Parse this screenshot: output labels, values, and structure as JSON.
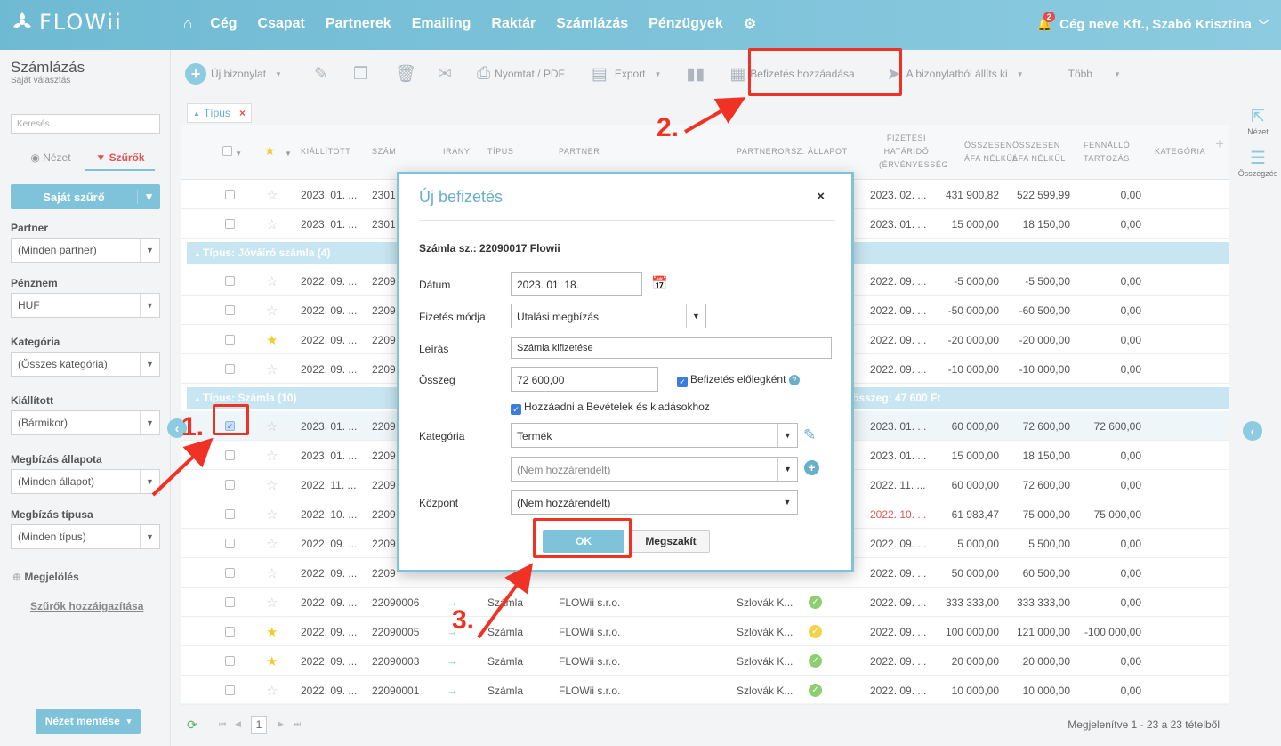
{
  "app": {
    "logo_text": "FLOWii",
    "company_user": "Cég neve Kft., Szabó Krisztina",
    "notification_count": "2"
  },
  "nav": [
    "Cég",
    "Csapat",
    "Partnerek",
    "Emailing",
    "Raktár",
    "Számlázás",
    "Pénzügyek"
  ],
  "sidebar": {
    "title": "Számlázás",
    "subtitle": "Saját választás",
    "search_placeholder": "Keresés...",
    "tab_view": "Nézet",
    "tab_filters": "Szűrők",
    "own_filter": "Saját szűrő",
    "filters": [
      {
        "label": "Partner",
        "value": "(Minden partner)"
      },
      {
        "label": "Pénznem",
        "value": "HUF"
      },
      {
        "label": "Kategória",
        "value": "(Összes kategória)"
      },
      {
        "label": "Kiállított",
        "value": "(Bármikor)"
      },
      {
        "label": "Megbízás állapota",
        "value": "(Minden állapot)"
      },
      {
        "label": "Megbízás típusa",
        "value": "(Minden típus)"
      }
    ],
    "mark": "Megjelölés",
    "assign_filters": "Szűrők hozzáigazítása",
    "save_view": "Nézet mentése"
  },
  "toolbar": {
    "new_doc": "Új bizonylat",
    "print": "Nyomtat / PDF",
    "export": "Export",
    "add_payment": "Befizetés hozzáadása",
    "create_from": "A bizonylatból állíts ki",
    "more": "Több"
  },
  "filter_chip": "Típus",
  "columns": {
    "issued": "KIÁLLÍTOTT",
    "number": "SZÁM",
    "direction": "IRÁNY",
    "type": "TÍPUS",
    "partner": "PARTNER",
    "country": "PARTNERORSZ.",
    "status": "ÁLLAPOT",
    "due1": "FIZETÉSI",
    "due2": "HATÁRIDŐ",
    "due3": "(ÉRVÉNYESSÉG",
    "net1": "ÖSSZESEN",
    "net2": "ÁFA NÉLKÜL",
    "gross1": "ÖSSZESEN",
    "gross2": "ÁFA NÉLKÜL",
    "debt1": "FENNÁLLÓ",
    "debt2": "TARTOZÁS",
    "category": "KATEGÓRIA"
  },
  "groups": [
    {
      "label": "Típus: Jóváíró számla (4)"
    },
    {
      "label": "Típus: Számla (10)",
      "sum": "összeg: 47 600 Ft"
    }
  ],
  "rows": [
    {
      "issued": "2023. 01. ...",
      "number": "2301",
      "due": "2023. 02. ...",
      "net": "431 900,82",
      "gross": "522 599,99",
      "debt": "0,00",
      "star": false
    },
    {
      "issued": "2023. 01. ...",
      "number": "2301",
      "due": "2023. 01. ...",
      "net": "15 000,00",
      "gross": "18 150,00",
      "debt": "0,00",
      "star": false
    },
    {
      "issued": "2022. 09. ...",
      "number": "2209",
      "due": "2022. 09. ...",
      "net": "-5 000,00",
      "gross": "-5 500,00",
      "debt": "0,00",
      "star": false
    },
    {
      "issued": "2022. 09. ...",
      "number": "2209",
      "due": "2022. 09. ...",
      "net": "-50 000,00",
      "gross": "-60 500,00",
      "debt": "0,00",
      "star": false
    },
    {
      "issued": "2022. 09. ...",
      "number": "2209",
      "due": "2022. 09. ...",
      "net": "-20 000,00",
      "gross": "-20 000,00",
      "debt": "0,00",
      "star": true
    },
    {
      "issued": "2022. 09. ...",
      "number": "2209",
      "due": "2022. 09. ...",
      "net": "-10 000,00",
      "gross": "-10 000,00",
      "debt": "0,00",
      "star": false
    },
    {
      "issued": "2023. 01. ...",
      "number": "2209",
      "due": "2023. 01. ...",
      "net": "60 000,00",
      "gross": "72 600,00",
      "debt": "72 600,00",
      "star": false,
      "checked": true
    },
    {
      "issued": "2023. 01. ...",
      "number": "2209",
      "due": "2023. 01. ...",
      "net": "15 000,00",
      "gross": "18 150,00",
      "debt": "0,00",
      "star": false
    },
    {
      "issued": "2022. 11. ...",
      "number": "2209",
      "due": "2022. 11. ...",
      "net": "60 000,00",
      "gross": "72 600,00",
      "debt": "0,00",
      "star": false
    },
    {
      "issued": "2022. 10. ...",
      "number": "2209",
      "due": "2022. 10. ...",
      "net": "61 983,47",
      "gross": "75 000,00",
      "debt": "75 000,00",
      "star": false,
      "due_red": true
    },
    {
      "issued": "2022. 09. ...",
      "number": "2209",
      "due": "2022. 09. ...",
      "net": "5 000,00",
      "gross": "5 500,00",
      "debt": "0,00",
      "star": false
    },
    {
      "issued": "2022. 09. ...",
      "number": "2209",
      "due": "2022. 09. ...",
      "net": "50 000,00",
      "gross": "60 500,00",
      "debt": "0,00",
      "star": false
    },
    {
      "issued": "2022. 09. ...",
      "number": "22090006",
      "type": "Számla",
      "partner": "FLOWii s.r.o.",
      "country": "Szlovák K...",
      "status": "ok",
      "due": "2022. 09. ...",
      "net": "333 333,00",
      "gross": "333 333,00",
      "debt": "0,00",
      "star": false
    },
    {
      "issued": "2022. 09. ...",
      "number": "22090005",
      "type": "Számla",
      "partner": "FLOWii s.r.o.",
      "country": "Szlovák K...",
      "status": "partial",
      "due": "2022. 09. ...",
      "net": "100 000,00",
      "gross": "121 000,00",
      "debt": "-100 000,00",
      "star": true
    },
    {
      "issued": "2022. 09. ...",
      "number": "22090003",
      "type": "Számla",
      "partner": "FLOWii s.r.o.",
      "country": "Szlovák K...",
      "status": "ok",
      "due": "2022. 09. ...",
      "net": "20 000,00",
      "gross": "20 000,00",
      "debt": "0,00",
      "star": true
    },
    {
      "issued": "2022. 09. ...",
      "number": "22090001",
      "type": "Számla",
      "partner": "FLOWii s.r.o.",
      "country": "Szlovák K...",
      "status": "ok",
      "due": "2022. 09. ...",
      "net": "10 000,00",
      "gross": "10 000,00",
      "debt": "0,00",
      "star": false
    }
  ],
  "footer": {
    "page": "1",
    "summary": "Megjelenítve 1 - 23 a 23 tételből"
  },
  "right_rail": {
    "view": "Nézet",
    "summary": "Összegzés"
  },
  "modal": {
    "title": "Új befizetés",
    "doc": "Számla sz.: 22090017 Flowii",
    "date_label": "Dátum",
    "date_value": "2023. 01. 18.",
    "method_label": "Fizetés módja",
    "method_value": "Utalási megbízás",
    "desc_label": "Leírás",
    "desc_value": "Számla kifizetése",
    "amount_label": "Összeg",
    "amount_value": "72 600,00",
    "advance_label": "Befizetés előlegként",
    "add_to_label": "Hozzáadni a Bevételek és kiadásokhoz",
    "category_label": "Kategória",
    "category_value": "Termék",
    "subcategory_value": "(Nem hozzárendelt)",
    "center_label": "Központ",
    "center_value": "(Nem hozzárendelt)",
    "ok": "OK",
    "cancel": "Megszakít"
  },
  "annotations": [
    "1.",
    "2.",
    "3."
  ],
  "colors": {
    "accent": "#7ec3d9",
    "highlight": "#ef3224",
    "header_start": "#6fbad3"
  }
}
